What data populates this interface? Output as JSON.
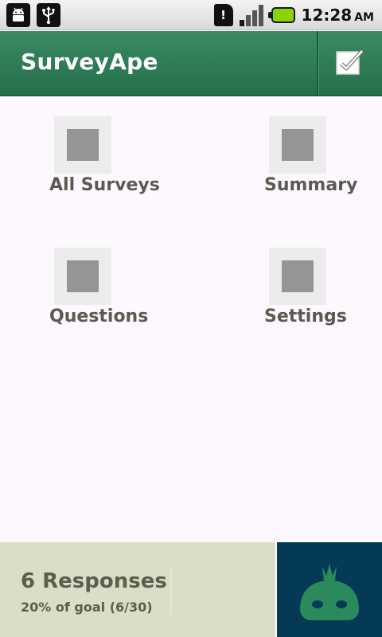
{
  "status_bar": {
    "left_icons": [
      "android-debug-icon",
      "usb-icon"
    ],
    "right_icons": [
      "sim-card-icon",
      "signal-icon",
      "battery-icon"
    ],
    "time": "12:28",
    "ampm": "AM",
    "colors": {
      "battery": "#8ad400"
    }
  },
  "header": {
    "title": "SurveyApe",
    "action_icon": "checkbox-check-icon",
    "colors": {
      "background": "#2e7b55"
    }
  },
  "dashboard": {
    "items": [
      {
        "label": "All Surveys",
        "icon": "placeholder-thumbnail-icon"
      },
      {
        "label": "Summary",
        "icon": "placeholder-thumbnail-icon"
      },
      {
        "label": "Questions",
        "icon": "placeholder-thumbnail-icon"
      },
      {
        "label": "Settings",
        "icon": "placeholder-thumbnail-icon"
      }
    ]
  },
  "footer": {
    "responses": "6 Responses",
    "goal": "20% of goal (6/30)",
    "logo_icon": "surveyape-mascot-icon",
    "colors": {
      "panel": "#d9dfc6",
      "logo_bg": "#053a56",
      "logo_fg": "#2a8a5c"
    }
  }
}
